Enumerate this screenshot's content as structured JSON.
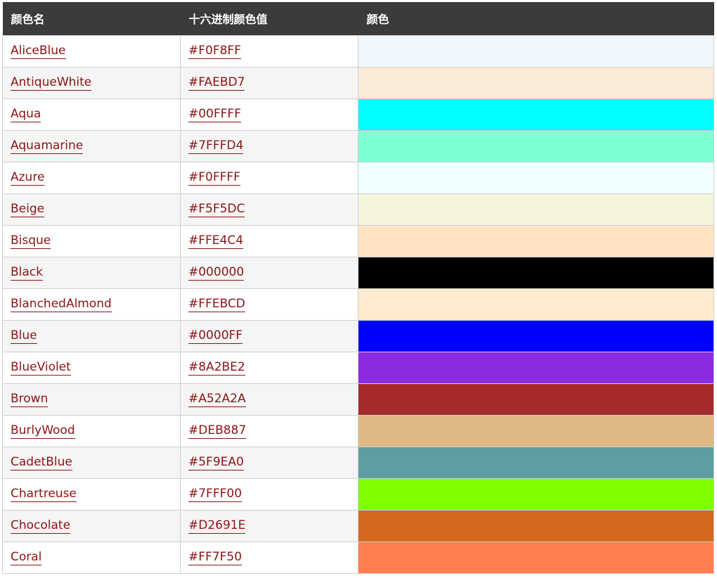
{
  "table": {
    "headers": [
      "颜色名",
      "十六进制颜色值",
      "颜色"
    ],
    "rows": [
      {
        "name": "AliceBlue",
        "hex": "#F0F8FF",
        "color": "#F0F8FF"
      },
      {
        "name": "AntiqueWhite",
        "hex": "#FAEBD7",
        "color": "#FAEBD7"
      },
      {
        "name": "Aqua",
        "hex": "#00FFFF",
        "color": "#00FFFF"
      },
      {
        "name": "Aquamarine",
        "hex": "#7FFFD4",
        "color": "#7FFFD4"
      },
      {
        "name": "Azure",
        "hex": "#F0FFFF",
        "color": "#F0FFFF"
      },
      {
        "name": "Beige",
        "hex": "#F5F5DC",
        "color": "#F5F5DC"
      },
      {
        "name": "Bisque",
        "hex": "#FFE4C4",
        "color": "#FFE4C4"
      },
      {
        "name": "Black",
        "hex": "#000000",
        "color": "#000000"
      },
      {
        "name": "BlanchedAlmond",
        "hex": "#FFEBCD",
        "color": "#FFEBCD"
      },
      {
        "name": "Blue",
        "hex": "#0000FF",
        "color": "#0000FF"
      },
      {
        "name": "BlueViolet",
        "hex": "#8A2BE2",
        "color": "#8A2BE2"
      },
      {
        "name": "Brown",
        "hex": "#A52A2A",
        "color": "#A52A2A"
      },
      {
        "name": "BurlyWood",
        "hex": "#DEB887",
        "color": "#DEB887"
      },
      {
        "name": "CadetBlue",
        "hex": "#5F9EA0",
        "color": "#5F9EA0"
      },
      {
        "name": "Chartreuse",
        "hex": "#7FFF00",
        "color": "#7FFF00"
      },
      {
        "name": "Chocolate",
        "hex": "#D2691E",
        "color": "#D2691E"
      },
      {
        "name": "Coral",
        "hex": "#FF7F50",
        "color": "#FF7F50"
      }
    ]
  },
  "colors": {
    "header_bg": "#3c3b39",
    "link": "#8a1414",
    "row_alt": "#f5f5f5"
  }
}
